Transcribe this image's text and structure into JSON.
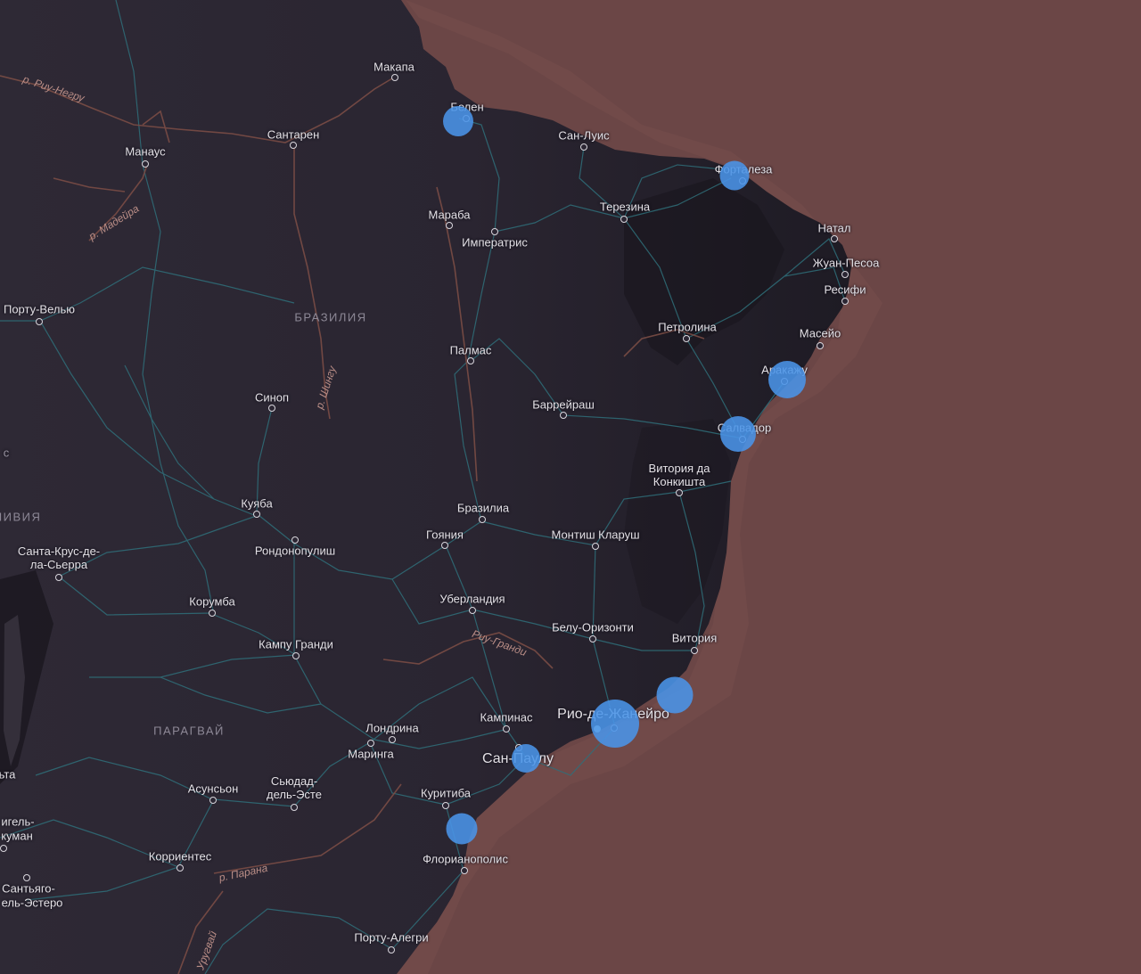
{
  "map": {
    "colors": {
      "land": "#2c2734",
      "land_dark": "#1d1a23",
      "ocean": "#6b4646",
      "roads": "#2f6f7a",
      "rivers": "#7a4c45",
      "marker": "#4a94e8"
    },
    "cities": [
      {
        "id": "makapa",
        "name": "Макапа"
      },
      {
        "id": "belen",
        "name": "Белен"
      },
      {
        "id": "san-luis",
        "name": "Сан-Луис"
      },
      {
        "id": "fortaleza",
        "name": "Форталеза"
      },
      {
        "id": "santaren",
        "name": "Сантарен"
      },
      {
        "id": "manaus",
        "name": "Манаус"
      },
      {
        "id": "teresina",
        "name": "Терезина"
      },
      {
        "id": "natal",
        "name": "Натал"
      },
      {
        "id": "maraba",
        "name": "Мараба"
      },
      {
        "id": "imperatris",
        "name": "Императрис"
      },
      {
        "id": "zhuan-pesoa",
        "name": "Жуан-Песоа"
      },
      {
        "id": "resifi",
        "name": "Ресифи"
      },
      {
        "id": "portu-velyu",
        "name": "Порту-Велью"
      },
      {
        "id": "petrolina",
        "name": "Петролина"
      },
      {
        "id": "maseio",
        "name": "Масейо"
      },
      {
        "id": "palmas",
        "name": "Палмас"
      },
      {
        "id": "arakazhu",
        "name": "Аракажу"
      },
      {
        "id": "sinop",
        "name": "Синоп"
      },
      {
        "id": "barreirash",
        "name": "Баррейраш"
      },
      {
        "id": "salvador",
        "name": "Салвадор"
      },
      {
        "id": "vitoria-da-konkishta",
        "name": "Витория да Конкишта"
      },
      {
        "id": "kuyaba",
        "name": "Куяба"
      },
      {
        "id": "brazilia-city",
        "name": "Бразилиа"
      },
      {
        "id": "goiania",
        "name": "Гояния"
      },
      {
        "id": "montish-klarush",
        "name": "Монтиш Кларуш"
      },
      {
        "id": "rondonopulish",
        "name": "Рондонопулиш"
      },
      {
        "id": "santa-krus",
        "name": "Санта-Крус-де-ла-Сьерра"
      },
      {
        "id": "korumba",
        "name": "Корумба"
      },
      {
        "id": "uberlandia",
        "name": "Уберландия"
      },
      {
        "id": "belu-orizonti",
        "name": "Белу-Оризонти"
      },
      {
        "id": "vitoria",
        "name": "Витория"
      },
      {
        "id": "kampu-grandi",
        "name": "Кампу Гранди"
      },
      {
        "id": "kampinas",
        "name": "Кампинас"
      },
      {
        "id": "rio",
        "name": "Рио-де-Жанейро"
      },
      {
        "id": "londrina",
        "name": "Лондрина"
      },
      {
        "id": "maringa",
        "name": "Маринга"
      },
      {
        "id": "san-paulu",
        "name": "Сан-Паулу"
      },
      {
        "id": "asunson",
        "name": "Асунсьон"
      },
      {
        "id": "syudad-del-este",
        "name": "Сьюдад-дель-Эсте"
      },
      {
        "id": "kuritiba",
        "name": "Куритиба"
      },
      {
        "id": "florianopolis",
        "name": "Флорианополис"
      },
      {
        "id": "korrientes",
        "name": "Корриентес"
      },
      {
        "id": "portu-alegri",
        "name": "Порту-Алегри"
      },
      {
        "id": "migel-tukuman",
        "name": "Мигель-Тукуман"
      },
      {
        "id": "santyago-del-estero",
        "name": "Сантьяго-дель-Эстеро"
      }
    ],
    "partial_labels": {
      "left_c": "с",
      "left_ivia": "ЛИВИЯ",
      "left_ta": "ьта",
      "migel": "игель-",
      "kuman": "куман",
      "santyago": "Сантьяго-",
      "del_estero": "ель-Эстеро"
    },
    "regions": {
      "brazil": "БРАЗИЛИЯ",
      "paraguay": "ПАРАГВАЙ"
    },
    "rivers": {
      "rio_negro": "р. Риу-Негру",
      "madeira": "р. Мадейра",
      "xingu": "р. Шингу",
      "rio_grande": "Риу-Гранди",
      "parana": "р. Парана",
      "uruguay": "р. Уругвай"
    },
    "markers": [
      {
        "id": "belen",
        "city": "Белен",
        "size": 1
      },
      {
        "id": "fortaleza",
        "city": "Форталеза",
        "size": 1
      },
      {
        "id": "arakazhu",
        "city": "Аракажу",
        "size": 1.3
      },
      {
        "id": "salvador",
        "city": "Салвадор",
        "size": 1.25
      },
      {
        "id": "vitoria",
        "city": "Витория",
        "size": 1.25
      },
      {
        "id": "rio",
        "city": "Рио-де-Жанейро",
        "size": 1.65
      },
      {
        "id": "san-paulu",
        "city": "Сан-Паулу",
        "size": 1
      },
      {
        "id": "florianopolis",
        "city": "Флорианополис",
        "size": 1.05
      }
    ]
  }
}
